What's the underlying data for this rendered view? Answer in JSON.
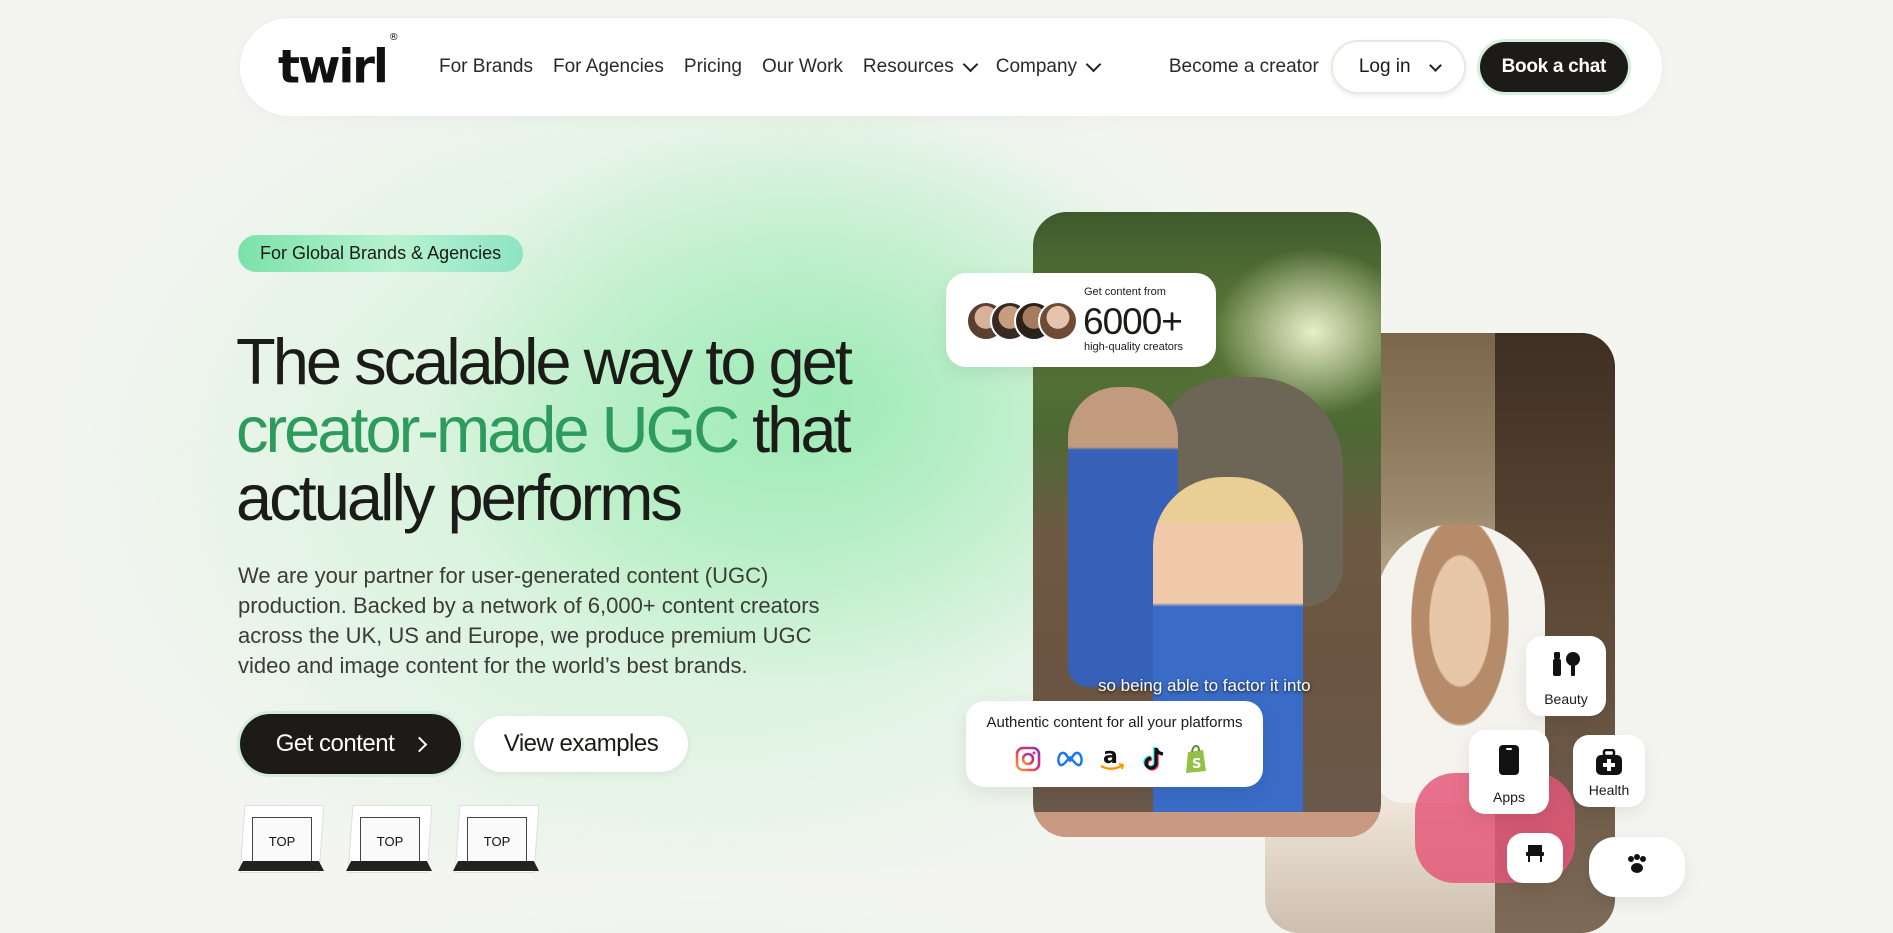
{
  "nav": {
    "logo": "twirl",
    "logo_mark": "®",
    "links": [
      {
        "label": "For Brands"
      },
      {
        "label": "For Agencies"
      },
      {
        "label": "Pricing"
      },
      {
        "label": "Our Work"
      },
      {
        "label": "Resources",
        "dropdown": true
      },
      {
        "label": "Company",
        "dropdown": true
      }
    ],
    "become_creator": "Become a creator",
    "login": "Log in",
    "book_chat": "Book a chat"
  },
  "hero": {
    "badge": "For Global Brands & Agencies",
    "headline_1": "The scalable way to get",
    "headline_green": "creator-made UGC",
    "headline_2": " that",
    "headline_3": "actually performs",
    "description": "We are your partner for user-generated content (UGC) production. Backed by a network of 6,000+ content creators across the UK, US and Europe, we produce premium UGC video and image content for the world’s best brands.",
    "cta_primary": "Get content",
    "cta_secondary": "View examples",
    "awards": [
      "TOP",
      "TOP",
      "TOP"
    ]
  },
  "stat_card": {
    "top": "Get content from",
    "number": "6000+",
    "bottom": "high-quality creators"
  },
  "video_caption": "so being able to factor it into",
  "platform_card": {
    "title": "Authentic content for all your platforms",
    "icons": [
      "instagram-icon",
      "meta-icon",
      "amazon-icon",
      "tiktok-icon",
      "shopify-icon"
    ]
  },
  "categories": {
    "beauty": "Beauty",
    "apps": "Apps",
    "health": "Health"
  },
  "colors": {
    "accent_green": "#2c9b5c",
    "dark_button": "#1d1b17"
  }
}
